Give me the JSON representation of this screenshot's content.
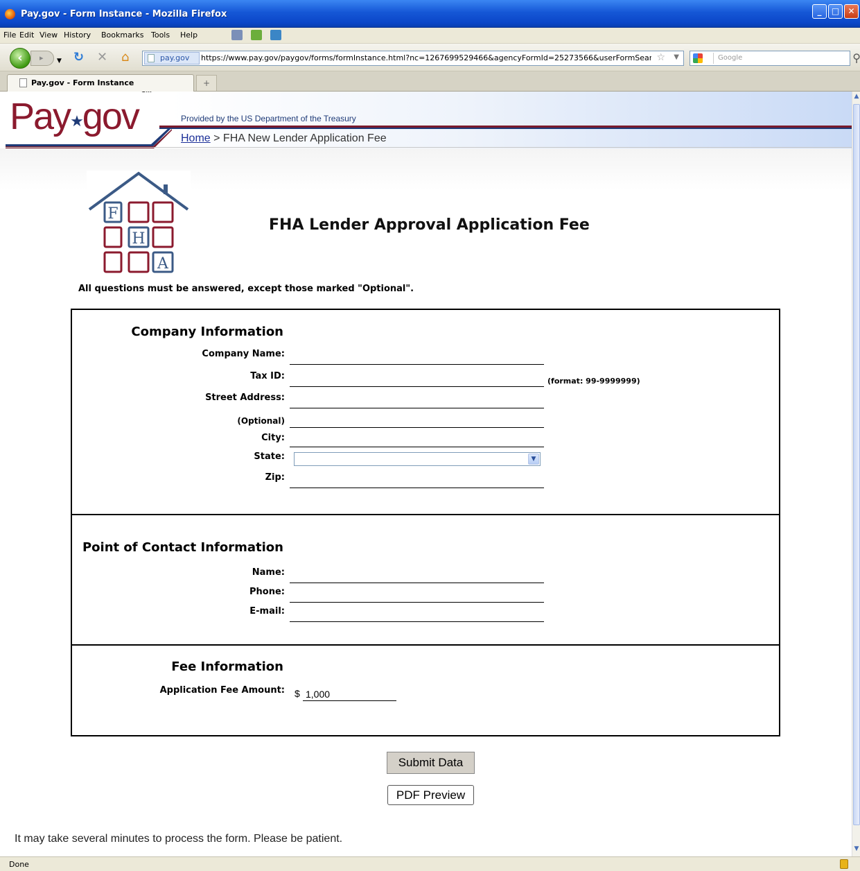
{
  "window": {
    "title": "Pay.gov - Form Instance - Mozilla Firefox",
    "controls": [
      "_",
      "□",
      "✕"
    ]
  },
  "menu": [
    "File",
    "Edit",
    "View",
    "History",
    "Bookmarks",
    "Tools",
    "Help"
  ],
  "nav": {
    "site_label": "pay.gov",
    "url": "https://www.pay.gov/paygov/forms/formInstance.html?nc=1267699529466&agencyFormId=25273566&userFormSearch=htt",
    "search_placeholder": "Google"
  },
  "tabs": [
    {
      "label": "Pay.gov - Form Instance"
    }
  ],
  "status": "Done",
  "header": {
    "logo_main": "Pay",
    "logo_rest": "gov",
    "logo_mark": "SM",
    "provided_by": "Provided by the US Department of the Treasury",
    "breadcrumb_home": "Home",
    "breadcrumb_sep": " > ",
    "breadcrumb_current": "FHA New Lender Application Fee"
  },
  "fha_logo_letters": [
    "F",
    "H",
    "A"
  ],
  "form": {
    "title": "FHA Lender Approval Application Fee",
    "instruction": "All questions must be answered, except those marked \"Optional\".",
    "company": {
      "heading": "Company Information",
      "company_name_label": "Company Name:",
      "tax_id_label": "Tax ID:",
      "tax_id_hint": "(format: 99-9999999)",
      "street_label": "Street Address:",
      "optional_label": "(Optional)",
      "city_label": "City:",
      "state_label": "State:",
      "zip_label": "Zip:"
    },
    "contact": {
      "heading": "Point of Contact Information",
      "name_label": "Name:",
      "phone_label": "Phone:",
      "email_label": "E-mail:"
    },
    "fee": {
      "heading": "Fee Information",
      "amount_label": "Application Fee Amount:",
      "currency": "$",
      "amount_value": "1,000"
    },
    "submit_label": "Submit Data",
    "pdf_label": "PDF Preview",
    "processing_note": "It may take several minutes to process the form. Please be patient."
  }
}
